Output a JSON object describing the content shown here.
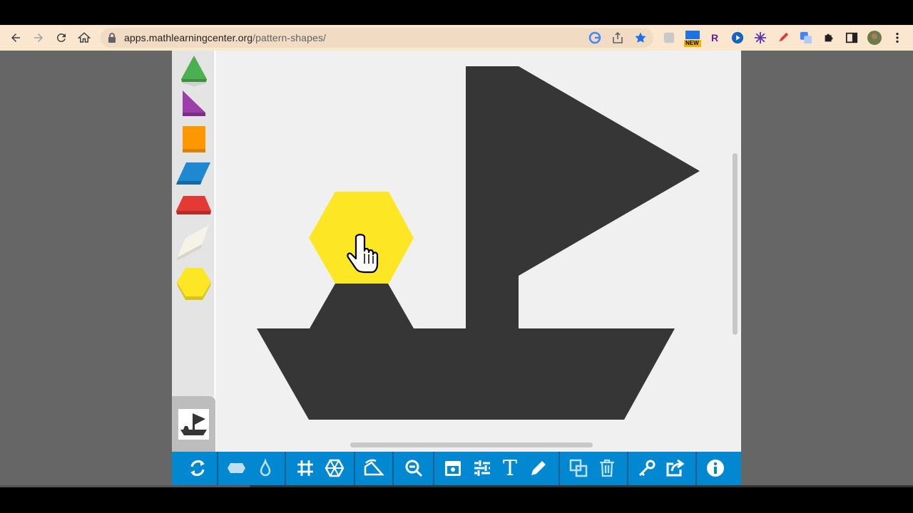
{
  "browser": {
    "url_domain": "apps.mathlearningcenter.org",
    "url_path": "/pattern-shapes/",
    "extensions": [
      "new-badge-extension",
      "r-extension",
      "play-extension",
      "sparkle-extension",
      "pen-extension",
      "translate-extension"
    ],
    "new_badge": "NEW",
    "r_label": "R"
  },
  "colors": {
    "accent": "#0288d1",
    "triangle": "#4caf50",
    "right_triangle": "#9c3fa8",
    "square": "#ff9800",
    "rhombus": "#1e88d0",
    "trapezoid": "#e53935",
    "thin_rhombus": "#f5f3e8",
    "hexagon": "#fde725",
    "silhouette": "#363636"
  },
  "palette": {
    "shapes": [
      "triangle",
      "right-triangle",
      "square",
      "rhombus",
      "trapezoid",
      "thin-rhombus",
      "hexagon"
    ]
  },
  "toolbar": {
    "buttons": [
      "refresh",
      "shapes",
      "color",
      "grid",
      "snap",
      "rotate",
      "zoom-out",
      "image",
      "adjust",
      "text",
      "pen",
      "duplicate",
      "delete",
      "key",
      "share",
      "info"
    ],
    "text_label": "T"
  }
}
